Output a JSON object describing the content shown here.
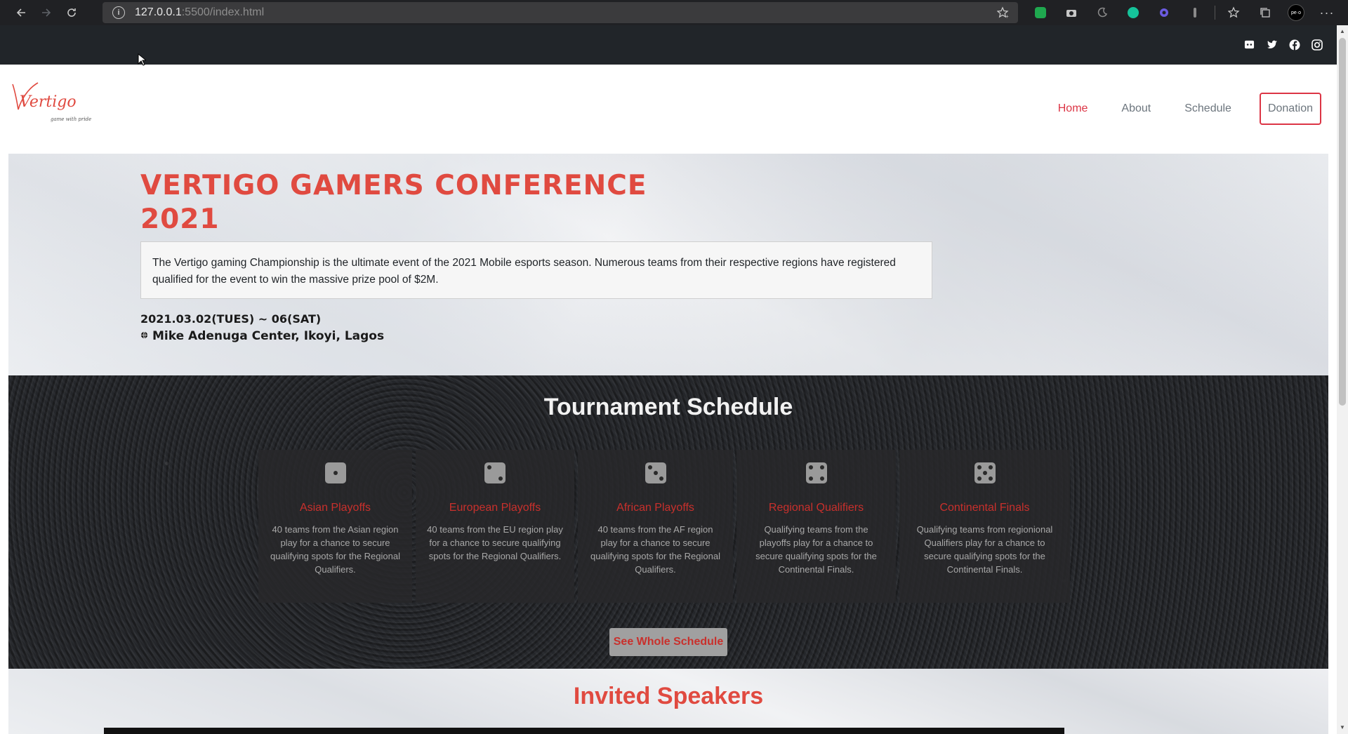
{
  "browser": {
    "url_host": "127.0.0.1",
    "url_path": ":5500/index.html",
    "icons": [
      "back-icon",
      "forward-icon",
      "reload-icon",
      "info-icon",
      "star-add-icon",
      "evernote-extension-icon",
      "camera-extension-icon",
      "moon-extension-icon",
      "grammarly-extension-icon",
      "gear-extension-icon",
      "extension-icon",
      "favorites-icon",
      "collections-icon",
      "profile-avatar",
      "more-icon"
    ],
    "profile_label": "pe·o"
  },
  "topbar": {
    "social": [
      "discord-icon",
      "twitter-icon",
      "facebook-icon",
      "instagram-icon"
    ]
  },
  "header": {
    "logo_text": "Vertigo",
    "logo_tagline": "game with pride",
    "nav": [
      {
        "label": "Home",
        "active": true
      },
      {
        "label": "About",
        "active": false
      },
      {
        "label": "Schedule",
        "active": false
      }
    ],
    "donation_label": "Donation"
  },
  "hero": {
    "title": "VERTIGO GAMERS CONFERENCE 2021",
    "description": "The Vertigo gaming Championship is the ultimate event of the 2021 Mobile esports season. Numerous teams from their respective regions have registered qualified for the event to win the massive prize pool of $2M.",
    "date": "2021.03.02(TUES) ~ 06(SAT)",
    "venue": "Mike Adenuga Center, Ikoyi, Lagos"
  },
  "schedule": {
    "title": "Tournament Schedule",
    "cards": [
      {
        "title": "Asian Playoffs",
        "desc": "40 teams from the Asian region play for a chance to secure qualifying spots for the Regional Qualifiers.",
        "die": 1
      },
      {
        "title": "European Playoffs",
        "desc": "40 teams from the EU region play for a chance to secure qualifying spots for the Regional Qualifiers.",
        "die": 2
      },
      {
        "title": "African Playoffs",
        "desc": "40 teams from the AF region play for a chance to secure qualifying spots for the Regional Qualifiers.",
        "die": 3
      },
      {
        "title": "Regional Qualifiers",
        "desc": "Qualifying teams from the playoffs play for a chance to secure qualifying spots for the Continental Finals.",
        "die": 4
      },
      {
        "title": "Continental Finals",
        "desc": "Qualifying teams from regionional Qualifiers play for a chance to secure qualifying spots for the Continental Finals.",
        "die": 5
      }
    ],
    "button_label": "See Whole Schedule"
  },
  "speakers": {
    "title": "Invited Speakers"
  },
  "colors": {
    "accent": "#dc3545",
    "title_red": "#e04a40",
    "topbar": "#212529"
  }
}
